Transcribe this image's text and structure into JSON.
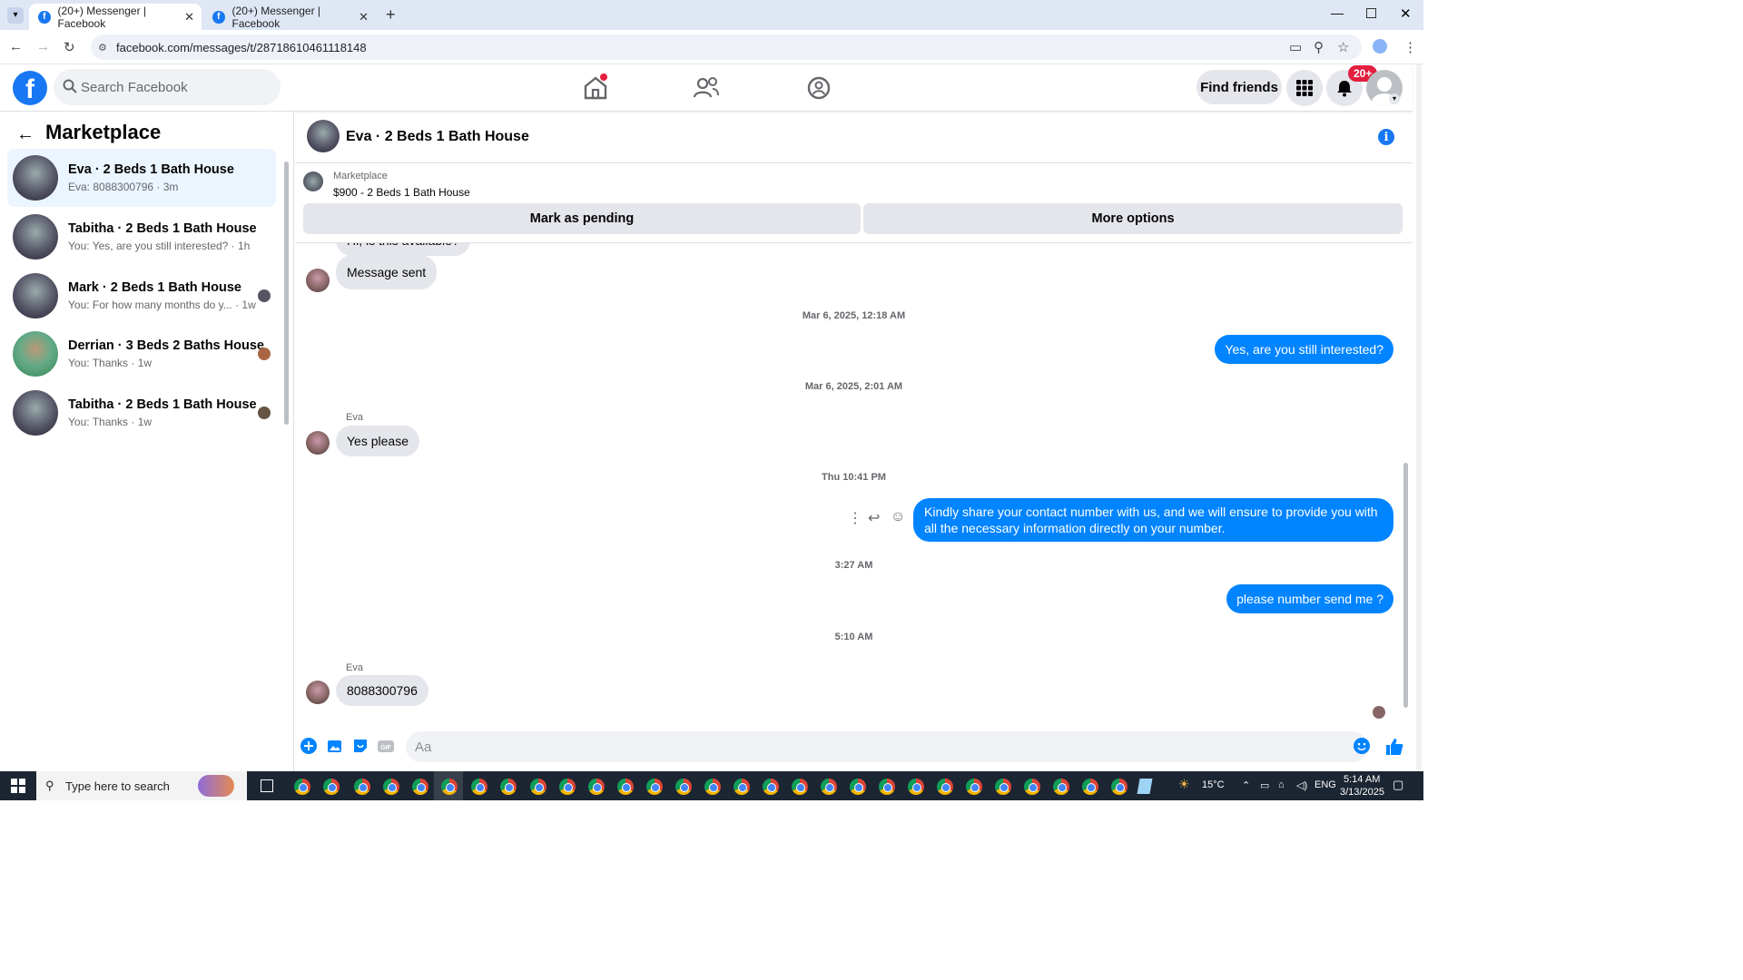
{
  "browser": {
    "tabs": [
      {
        "title": "(20+) Messenger | Facebook",
        "active": true
      },
      {
        "title": "(20+) Messenger | Facebook",
        "active": false
      }
    ],
    "url": "facebook.com/messages/t/28718610461118148"
  },
  "fb": {
    "search_placeholder": "Search Facebook",
    "find_friends": "Find friends",
    "notif_badge": "20+"
  },
  "sidebar": {
    "title": "Marketplace",
    "conversations": [
      {
        "name": "Eva · 2 Beds 1 Bath House",
        "snippet": "Eva: 8088300796 · 3m",
        "selected": true
      },
      {
        "name": "Tabitha · 2 Beds 1 Bath House",
        "snippet": "You: Yes, are you still interested? · 1h"
      },
      {
        "name": "Mark · 2 Beds 1 Bath House",
        "snippet": "You: For how many months do y... · 1w"
      },
      {
        "name": "Derrian · 3 Beds 2 Baths House",
        "snippet": "You: Thanks · 1w"
      },
      {
        "name": "Tabitha · 2 Beds 1 Bath House",
        "snippet": "You: Thanks · 1w"
      }
    ]
  },
  "chat": {
    "title": "Eva · 2 Beds 1 Bath House",
    "listing_category": "Marketplace",
    "listing_title": "$900 - 2 Beds 1 Bath House",
    "mark_pending": "Mark as pending",
    "more_options": "More options",
    "partial_msg": "Hi, is this available?",
    "messages": [
      {
        "text": "Message sent"
      },
      {
        "stamp": "Mar 6, 2025, 12:18 AM"
      },
      {
        "text": "Yes, are you still interested?"
      },
      {
        "stamp": "Mar 6, 2025, 2:01 AM"
      },
      {
        "sender": "Eva",
        "text": "Yes please"
      },
      {
        "stamp": "Thu 10:41 PM"
      },
      {
        "text": "Kindly share your contact number with us, and we will ensure to provide you with all the necessary information directly on your number."
      },
      {
        "stamp": "3:27 AM"
      },
      {
        "text": "please number send me ?"
      },
      {
        "stamp": "5:10 AM"
      },
      {
        "sender": "Eva",
        "text": "8088300796"
      }
    ],
    "composer_placeholder": "Aa"
  },
  "taskbar": {
    "search_placeholder": "Type here to search",
    "temperature": "15°C",
    "language": "ENG",
    "time": "5:14 AM",
    "date": "3/13/2025"
  },
  "colors": {
    "fb_blue": "#1877f2",
    "bubble_out": "#0084ff",
    "bubble_in": "#e4e6eb",
    "badge_red": "#e41e3f"
  }
}
